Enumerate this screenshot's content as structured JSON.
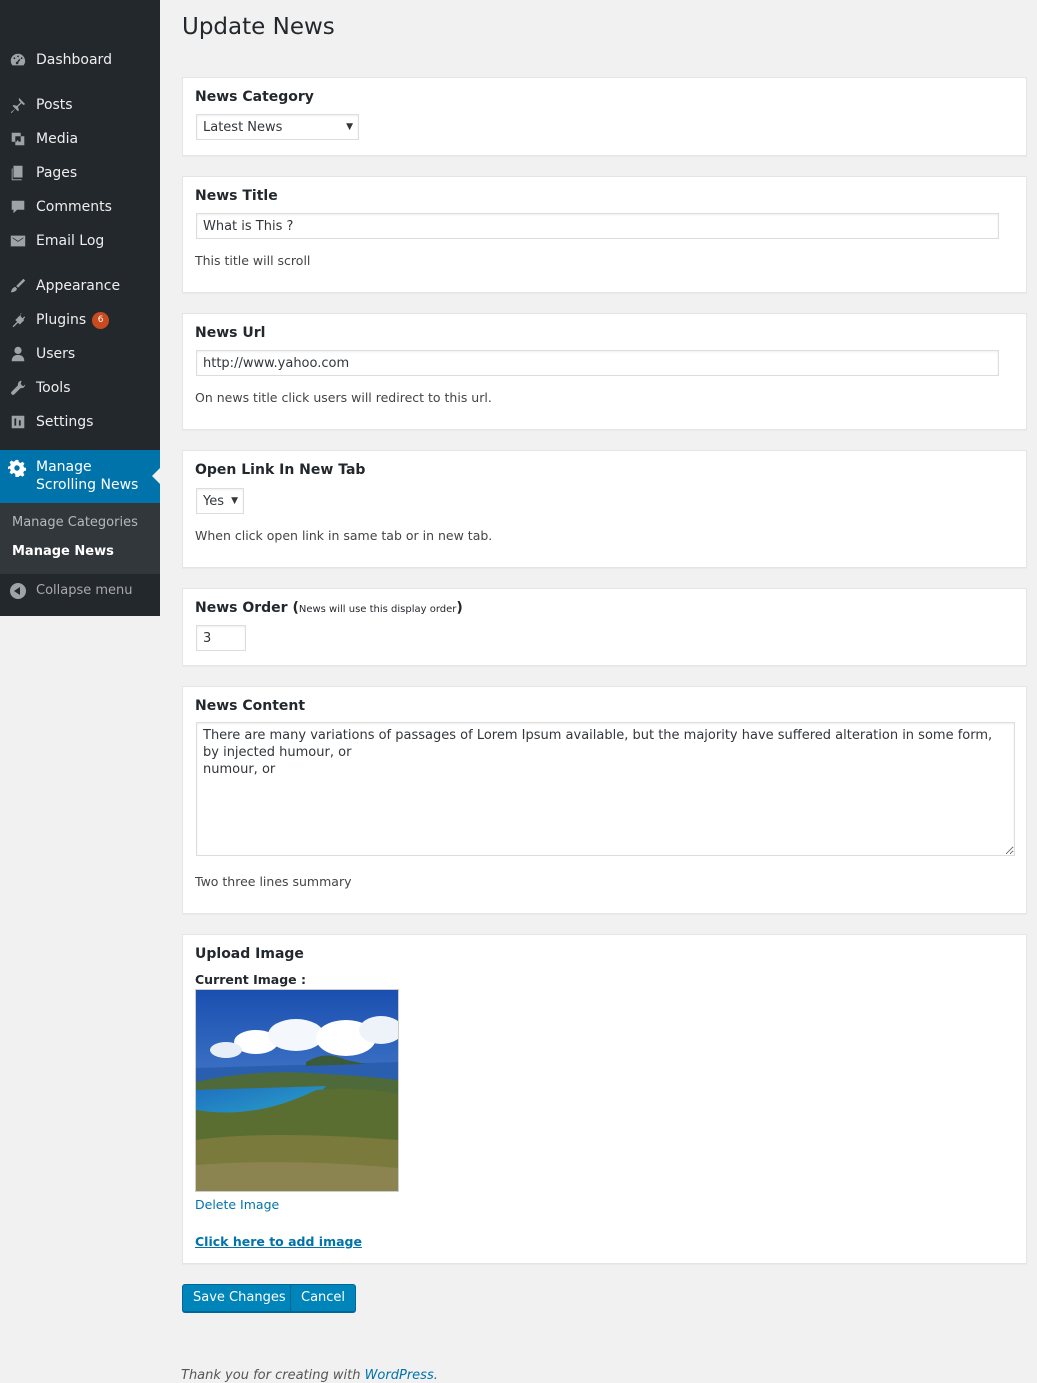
{
  "sidebar": {
    "items": [
      {
        "label": "Dashboard",
        "icon": "dashboard-icon"
      },
      {
        "label": "Posts",
        "icon": "pin-icon"
      },
      {
        "label": "Media",
        "icon": "media-icon"
      },
      {
        "label": "Pages",
        "icon": "pages-icon"
      },
      {
        "label": "Comments",
        "icon": "comment-icon"
      },
      {
        "label": "Email Log",
        "icon": "email-icon"
      },
      {
        "label": "Appearance",
        "icon": "brush-icon"
      },
      {
        "label": "Plugins",
        "icon": "plug-icon",
        "badge": "6"
      },
      {
        "label": "Users",
        "icon": "user-icon"
      },
      {
        "label": "Tools",
        "icon": "wrench-icon"
      },
      {
        "label": "Settings",
        "icon": "settings-icon"
      }
    ],
    "active": {
      "label": "Manage Scrolling News",
      "icon": "gear-icon"
    },
    "submenu": [
      "Manage Categories",
      "Manage News"
    ],
    "collapse_label": "Collapse menu"
  },
  "page": {
    "title": "Update News"
  },
  "form": {
    "category": {
      "label": "News Category",
      "value": "Latest News"
    },
    "title": {
      "label": "News Title",
      "value": "What is This ?",
      "help": "This title will scroll"
    },
    "url": {
      "label": "News Url",
      "value": "http://www.yahoo.com",
      "help": "On news title click users will redirect to this url."
    },
    "new_tab": {
      "label": "Open Link In New Tab",
      "value": "Yes",
      "help": "When click open link in same tab or in new tab."
    },
    "order": {
      "label": "News Order (",
      "hint": "News will use this display order",
      "close": ")",
      "value": "3"
    },
    "content": {
      "label": "News Content",
      "value": "There are many variations of passages of Lorem Ipsum available, but the majority have suffered alteration in some form, by injected humour, or\nnumour, or",
      "help": "Two three lines summary"
    },
    "image": {
      "label": "Upload Image",
      "current_label": "Current Image :",
      "delete_label": "Delete Image",
      "add_label": "Click here to add image"
    }
  },
  "buttons": {
    "save": "Save Changes",
    "cancel": "Cancel"
  },
  "footer": {
    "text": "Thank you for creating with ",
    "link": "WordPress",
    "end": "."
  },
  "colors": {
    "sidebar": "#23282d",
    "active": "#0073aa",
    "button": "#0085ba",
    "badge": "#ca4a1f"
  }
}
